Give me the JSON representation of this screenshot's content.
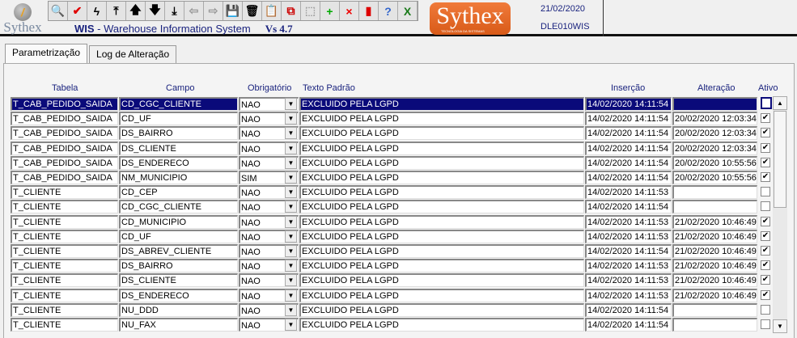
{
  "header": {
    "logo_text": "Sythex",
    "app_short": "WIS",
    "app_name": " - Warehouse Information System",
    "version": "Vs 4.7",
    "brand": "Sythex",
    "brand_tagline": "TECNOLOGIA DA SISTEMAS",
    "date": "21/02/2020",
    "program": "DLE010WIS"
  },
  "toolbar": [
    {
      "name": "find-icon",
      "glyph": "🔍"
    },
    {
      "name": "confirm-check-icon",
      "glyph": "✔",
      "color": "#e00000"
    },
    {
      "name": "lightning-icon",
      "glyph": "ϟ"
    },
    {
      "name": "first-record-icon",
      "glyph": "⤒"
    },
    {
      "name": "previous-record-icon",
      "glyph": "🡅"
    },
    {
      "name": "next-record-icon",
      "glyph": "🡇"
    },
    {
      "name": "last-record-icon",
      "glyph": "⤓"
    },
    {
      "name": "back-arrow-icon",
      "glyph": "⇦",
      "color": "#999"
    },
    {
      "name": "forward-arrow-icon",
      "glyph": "⇨",
      "color": "#999"
    },
    {
      "name": "save-icon",
      "glyph": "💾"
    },
    {
      "name": "trash-icon",
      "glyph": "🗑"
    },
    {
      "name": "clipboard-icon",
      "glyph": "📋"
    },
    {
      "name": "copy-icon",
      "glyph": "⧉",
      "color": "#c00"
    },
    {
      "name": "select-grid-icon",
      "glyph": "⬚",
      "color": "#aaa"
    },
    {
      "name": "add-record-icon",
      "glyph": "+",
      "color": "#0a0"
    },
    {
      "name": "delete-record-icon",
      "glyph": "×",
      "color": "#e00"
    },
    {
      "name": "exit-door-icon",
      "glyph": "▮",
      "color": "#d00"
    },
    {
      "name": "help-icon",
      "glyph": "?",
      "color": "#36c"
    },
    {
      "name": "excel-export-icon",
      "glyph": "X",
      "color": "#1a7a1a"
    }
  ],
  "tabs": [
    {
      "label": "Parametrização",
      "active": true
    },
    {
      "label": "Log de Alteração",
      "active": false
    }
  ],
  "columns": {
    "tabela": "Tabela",
    "campo": "Campo",
    "obrigatorio": "Obrigatório",
    "texto": "Texto Padrão",
    "insercao": "Inserção",
    "alteracao": "Alteração",
    "ativo": "Ativo"
  },
  "rows": [
    {
      "tabela": "T_CAB_PEDIDO_SAIDA",
      "campo": "CD_CGC_CLIENTE",
      "obrigatorio": "NAO",
      "texto": "EXCLUIDO PELA LGPD",
      "insercao": "14/02/2020 14:11:54",
      "alteracao": "",
      "ativo": false,
      "selected": true
    },
    {
      "tabela": "T_CAB_PEDIDO_SAIDA",
      "campo": "CD_UF",
      "obrigatorio": "NAO",
      "texto": "EXCLUIDO PELA LGPD",
      "insercao": "14/02/2020 14:11:54",
      "alteracao": "20/02/2020 12:03:34",
      "ativo": true
    },
    {
      "tabela": "T_CAB_PEDIDO_SAIDA",
      "campo": "DS_BAIRRO",
      "obrigatorio": "NAO",
      "texto": "EXCLUIDO PELA LGPD",
      "insercao": "14/02/2020 14:11:54",
      "alteracao": "20/02/2020 12:03:34",
      "ativo": true
    },
    {
      "tabela": "T_CAB_PEDIDO_SAIDA",
      "campo": "DS_CLIENTE",
      "obrigatorio": "NAO",
      "texto": "EXCLUIDO PELA LGPD",
      "insercao": "14/02/2020 14:11:54",
      "alteracao": "20/02/2020 12:03:34",
      "ativo": true
    },
    {
      "tabela": "T_CAB_PEDIDO_SAIDA",
      "campo": "DS_ENDERECO",
      "obrigatorio": "NAO",
      "texto": "EXCLUIDO PELA LGPD",
      "insercao": "14/02/2020 14:11:54",
      "alteracao": "20/02/2020 10:55:56",
      "ativo": true
    },
    {
      "tabela": "T_CAB_PEDIDO_SAIDA",
      "campo": "NM_MUNICIPIO",
      "obrigatorio": "SIM",
      "texto": "EXCLUIDO PELA LGPD",
      "insercao": "14/02/2020 14:11:54",
      "alteracao": "20/02/2020 10:55:56",
      "ativo": true
    },
    {
      "tabela": "T_CLIENTE",
      "campo": "CD_CEP",
      "obrigatorio": "NAO",
      "texto": "EXCLUIDO PELA LGPD",
      "insercao": "14/02/2020 14:11:53",
      "alteracao": "",
      "ativo": false
    },
    {
      "tabela": "T_CLIENTE",
      "campo": "CD_CGC_CLIENTE",
      "obrigatorio": "NAO",
      "texto": "EXCLUIDO PELA LGPD",
      "insercao": "14/02/2020 14:11:54",
      "alteracao": "",
      "ativo": false
    },
    {
      "tabela": "T_CLIENTE",
      "campo": "CD_MUNICIPIO",
      "obrigatorio": "NAO",
      "texto": "EXCLUIDO PELA LGPD",
      "insercao": "14/02/2020 14:11:53",
      "alteracao": "21/02/2020 10:46:49",
      "ativo": true
    },
    {
      "tabela": "T_CLIENTE",
      "campo": "CD_UF",
      "obrigatorio": "NAO",
      "texto": "EXCLUIDO PELA LGPD",
      "insercao": "14/02/2020 14:11:53",
      "alteracao": "21/02/2020 10:46:49",
      "ativo": true
    },
    {
      "tabela": "T_CLIENTE",
      "campo": "DS_ABREV_CLIENTE",
      "obrigatorio": "NAO",
      "texto": "EXCLUIDO PELA LGPD",
      "insercao": "14/02/2020 14:11:54",
      "alteracao": "21/02/2020 10:46:49",
      "ativo": true
    },
    {
      "tabela": "T_CLIENTE",
      "campo": "DS_BAIRRO",
      "obrigatorio": "NAO",
      "texto": "EXCLUIDO PELA LGPD",
      "insercao": "14/02/2020 14:11:53",
      "alteracao": "21/02/2020 10:46:49",
      "ativo": true
    },
    {
      "tabela": "T_CLIENTE",
      "campo": "DS_CLIENTE",
      "obrigatorio": "NAO",
      "texto": "EXCLUIDO PELA LGPD",
      "insercao": "14/02/2020 14:11:53",
      "alteracao": "21/02/2020 10:46:49",
      "ativo": true
    },
    {
      "tabela": "T_CLIENTE",
      "campo": "DS_ENDERECO",
      "obrigatorio": "NAO",
      "texto": "EXCLUIDO PELA LGPD",
      "insercao": "14/02/2020 14:11:53",
      "alteracao": "21/02/2020 10:46:49",
      "ativo": true
    },
    {
      "tabela": "T_CLIENTE",
      "campo": "NU_DDD",
      "obrigatorio": "NAO",
      "texto": "EXCLUIDO PELA LGPD",
      "insercao": "14/02/2020 14:11:54",
      "alteracao": "",
      "ativo": false
    },
    {
      "tabela": "T_CLIENTE",
      "campo": "NU_FAX",
      "obrigatorio": "NAO",
      "texto": "EXCLUIDO PELA LGPD",
      "insercao": "14/02/2020 14:11:54",
      "alteracao": "",
      "ativo": false
    }
  ]
}
